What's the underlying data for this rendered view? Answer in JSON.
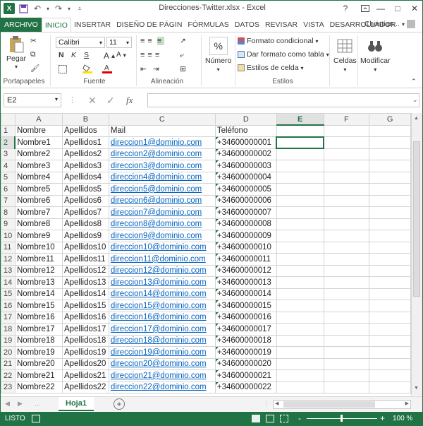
{
  "window": {
    "title": "Direcciones-Twitter.xlsx - Excel",
    "help": "?",
    "minimize": "—",
    "maximize": "□",
    "close": "✕"
  },
  "tabs": [
    {
      "label": "ARCHIVO"
    },
    {
      "label": "INICIO"
    },
    {
      "label": "INSERTAR"
    },
    {
      "label": "DISEÑO DE PÁGIN"
    },
    {
      "label": "FÓRMULAS"
    },
    {
      "label": "DATOS"
    },
    {
      "label": "REVISAR"
    },
    {
      "label": "VISTA"
    },
    {
      "label": "DESARROLLADOR"
    }
  ],
  "user": "Christian...",
  "ribbon": {
    "paste": "Pegar",
    "font_name": "Calibri",
    "font_size": "11",
    "conditional_format": "Formato condicional",
    "format_as_table": "Dar formato como tabla",
    "cell_styles": "Estilos de celda",
    "number": "Número",
    "cells": "Celdas",
    "edit": "Modificar",
    "groups": {
      "clipboard": "Portapapeles",
      "font": "Fuente",
      "alignment": "Alineación",
      "styles": "Estilos"
    }
  },
  "formula_bar": {
    "name_box": "E2",
    "fx": "fx",
    "value": ""
  },
  "columns": [
    "A",
    "B",
    "C",
    "D",
    "E",
    "F",
    "G"
  ],
  "selected_column": "E",
  "selected_row": "2",
  "rows": [
    {
      "n": "1",
      "a": "Nombre",
      "b": "Apellidos",
      "c": "Mail",
      "d": "Teléfono"
    },
    {
      "n": "2",
      "a": "Nombre1",
      "b": "Apellidos1",
      "c": "direccion1@dominio.com",
      "d": "+34600000001"
    },
    {
      "n": "3",
      "a": "Nombre2",
      "b": "Apellidos2",
      "c": "direccion2@dominio.com",
      "d": "+34600000002"
    },
    {
      "n": "4",
      "a": "Nombre3",
      "b": "Apellidos3",
      "c": "direccion3@dominio.com",
      "d": "+34600000003"
    },
    {
      "n": "5",
      "a": "Nombre4",
      "b": "Apellidos4",
      "c": "direccion4@dominio.com",
      "d": "+34600000004"
    },
    {
      "n": "6",
      "a": "Nombre5",
      "b": "Apellidos5",
      "c": "direccion5@dominio.com",
      "d": "+34600000005"
    },
    {
      "n": "7",
      "a": "Nombre6",
      "b": "Apellidos6",
      "c": "direccion6@dominio.com",
      "d": "+34600000006"
    },
    {
      "n": "8",
      "a": "Nombre7",
      "b": "Apellidos7",
      "c": "direccion7@dominio.com",
      "d": "+34600000007"
    },
    {
      "n": "9",
      "a": "Nombre8",
      "b": "Apellidos8",
      "c": "direccion8@dominio.com",
      "d": "+34600000008"
    },
    {
      "n": "10",
      "a": "Nombre9",
      "b": "Apellidos9",
      "c": "direccion9@dominio.com",
      "d": "+34600000009"
    },
    {
      "n": "11",
      "a": "Nombre10",
      "b": "Apellidos10",
      "c": "direccion10@dominio.com",
      "d": "+34600000010"
    },
    {
      "n": "12",
      "a": "Nombre11",
      "b": "Apellidos11",
      "c": "direccion11@dominio.com",
      "d": "+34600000011"
    },
    {
      "n": "13",
      "a": "Nombre12",
      "b": "Apellidos12",
      "c": "direccion12@dominio.com",
      "d": "+34600000012"
    },
    {
      "n": "14",
      "a": "Nombre13",
      "b": "Apellidos13",
      "c": "direccion13@dominio.com",
      "d": "+34600000013"
    },
    {
      "n": "15",
      "a": "Nombre14",
      "b": "Apellidos14",
      "c": "direccion14@dominio.com",
      "d": "+34600000014"
    },
    {
      "n": "16",
      "a": "Nombre15",
      "b": "Apellidos15",
      "c": "direccion15@dominio.com",
      "d": "+34600000015"
    },
    {
      "n": "17",
      "a": "Nombre16",
      "b": "Apellidos16",
      "c": "direccion16@dominio.com",
      "d": "+34600000016"
    },
    {
      "n": "18",
      "a": "Nombre17",
      "b": "Apellidos17",
      "c": "direccion17@dominio.com",
      "d": "+34600000017"
    },
    {
      "n": "19",
      "a": "Nombre18",
      "b": "Apellidos18",
      "c": "direccion18@dominio.com",
      "d": "+34600000018"
    },
    {
      "n": "20",
      "a": "Nombre19",
      "b": "Apellidos19",
      "c": "direccion19@dominio.com",
      "d": "+34600000019"
    },
    {
      "n": "21",
      "a": "Nombre20",
      "b": "Apellidos20",
      "c": "direccion20@dominio.com",
      "d": "+34600000020"
    },
    {
      "n": "22",
      "a": "Nombre21",
      "b": "Apellidos21",
      "c": "direccion21@dominio.com",
      "d": "+34600000021"
    },
    {
      "n": "23",
      "a": "Nombre22",
      "b": "Apellidos22",
      "c": "direccion22@dominio.com",
      "d": "+34600000022"
    }
  ],
  "sheet_tab": "Hoja1",
  "status": {
    "mode": "LISTO",
    "zoom": "100 %",
    "zoom_minus": "-",
    "zoom_plus": "+"
  },
  "colors": {
    "accent": "#217346",
    "link": "#0563c1"
  }
}
